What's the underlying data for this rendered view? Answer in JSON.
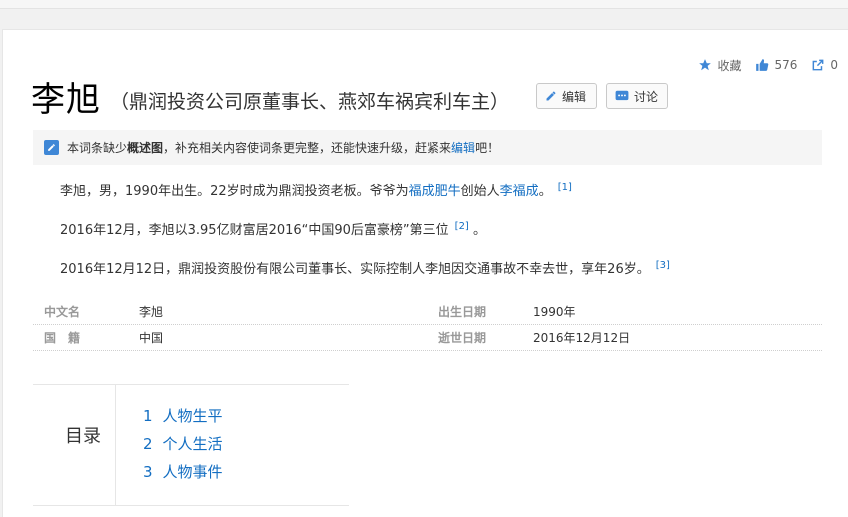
{
  "actions": {
    "favorite_label": "收藏",
    "like_count": "576",
    "share_count": "0"
  },
  "header": {
    "title": "李旭",
    "subtitle": "（鼎润投资公司原董事长、燕郊车祸宾利车主）",
    "edit_label": "编辑",
    "discuss_label": "讨论"
  },
  "notice": {
    "pre": "本词条缺少",
    "bold": "概述图",
    "mid": "，补充相关内容使词条更完整，还能快速升级，赶紧来",
    "link": "编辑",
    "post": "吧！"
  },
  "paragraphs": {
    "p1_a": "李旭，男，1990年出生。22岁时成为鼎润投资老板。爷爷为",
    "p1_link1": "福成肥牛",
    "p1_b": "创始人",
    "p1_link2": "李福成",
    "p1_c": "。",
    "p1_ref": "[1]",
    "p2_text": "2016年12月，李旭以3.95亿财富居2016“中国90后富豪榜”第三位",
    "p2_ref": "[2]",
    "p2_end": "。",
    "p3_text": "2016年12月12日，鼎润投资股份有限公司董事长、实际控制人李旭因交通事故不幸去世，享年26岁。",
    "p3_ref": "[3]"
  },
  "basic_info": [
    {
      "k1": "中文名",
      "v1": "李旭",
      "k2": "出生日期",
      "v2": "1990年"
    },
    {
      "k1": "国　籍",
      "v1": "中国",
      "k2": "逝世日期",
      "v2": "2016年12月12日"
    }
  ],
  "toc": {
    "heading": "目录",
    "items": [
      {
        "num": "1",
        "label": "人物生平"
      },
      {
        "num": "2",
        "label": "个人生活"
      },
      {
        "num": "3",
        "label": "人物事件"
      }
    ]
  },
  "colors": {
    "link": "#136ec2",
    "accent_icon": "#3f87d6"
  }
}
